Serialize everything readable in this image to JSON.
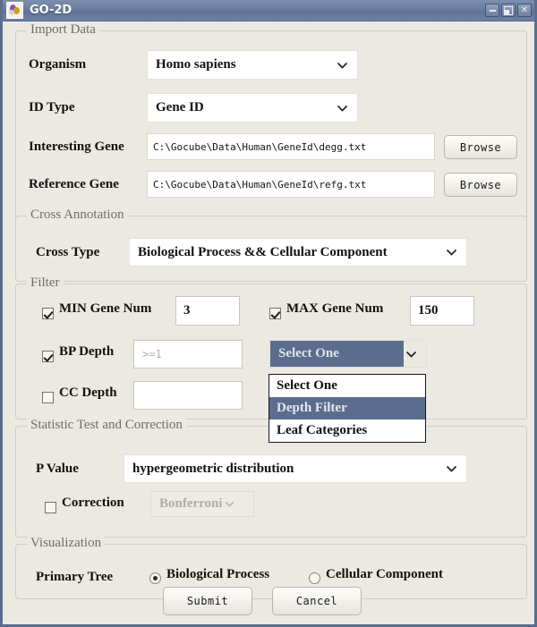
{
  "window": {
    "title": "GO-2D",
    "icon": "app-icon",
    "buttons": {
      "minimize": "minimize-icon",
      "maximize": "maximize-icon",
      "close": "close-icon"
    }
  },
  "import_data": {
    "legend": "Import Data",
    "organism_label": "Organism",
    "organism_value": "Homo sapiens",
    "id_type_label": "ID Type",
    "id_type_value": "Gene ID",
    "interesting_gene_label": "Interesting Gene",
    "interesting_gene_path": "C:\\Gocube\\Data\\Human\\GeneId\\degg.txt",
    "reference_gene_label": "Reference Gene",
    "reference_gene_path": "C:\\Gocube\\Data\\Human\\GeneId\\refg.txt",
    "browse_label_1": "Browse",
    "browse_label_2": "Browse"
  },
  "cross_annotation": {
    "legend": "Cross Annotation",
    "cross_type_label": "Cross Type",
    "cross_type_value": "Biological Process && Cellular Component"
  },
  "filter": {
    "legend": "Filter",
    "min_gene_num_label": "MIN Gene Num",
    "min_gene_num_value": "3",
    "min_gene_num_checked": true,
    "max_gene_num_label": "MAX Gene Num",
    "max_gene_num_value": "150",
    "max_gene_num_checked": true,
    "bp_depth_label": "BP Depth",
    "bp_depth_placeholder": ">=1",
    "bp_depth_checked": true,
    "cc_depth_label": "CC Depth",
    "cc_depth_value": "",
    "cc_depth_checked": false,
    "depth_mode_value": "Select One",
    "depth_mode_options": [
      "Select One",
      "Depth Filter",
      "Leaf Categories"
    ],
    "depth_mode_highlighted": "Depth Filter"
  },
  "statistic": {
    "legend": "Statistic Test and Correction",
    "p_value_label": "P Value",
    "p_value_value": "hypergeometric distribution",
    "correction_label": "Correction",
    "correction_checked": false,
    "correction_value": "Bonferroni"
  },
  "visualization": {
    "legend": "Visualization",
    "primary_tree_label": "Primary Tree",
    "option_bp": "Biological Process",
    "option_cc": "Cellular Component",
    "selected": "Biological Process"
  },
  "actions": {
    "submit_label": "Submit",
    "cancel_label": "Cancel"
  },
  "colors": {
    "titlebar": "#697d9e",
    "selection": "#5a6d8c",
    "background": "#ece9e3"
  }
}
